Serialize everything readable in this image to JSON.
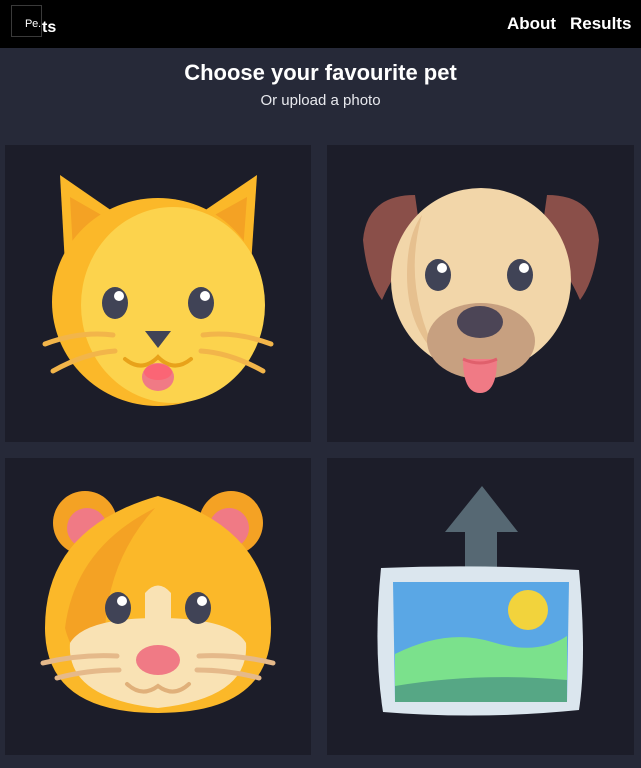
{
  "navbar": {
    "logo_alt": "Pe.",
    "logo_text": "ts",
    "links": [
      {
        "label": "About"
      },
      {
        "label": "Results"
      }
    ]
  },
  "main": {
    "title": "Choose your favourite pet",
    "subtitle": "Or upload a photo"
  },
  "tiles": [
    {
      "pet": "cat",
      "icon": "cat-icon"
    },
    {
      "pet": "dog",
      "icon": "dog-icon"
    },
    {
      "pet": "hamster",
      "icon": "hamster-icon"
    },
    {
      "pet": "upload",
      "icon": "upload-photo-icon"
    }
  ],
  "colors": {
    "navbar_bg": "#000000",
    "page_bg": "#262938",
    "tile_bg": "#1c1d29",
    "text": "#ffffff"
  }
}
